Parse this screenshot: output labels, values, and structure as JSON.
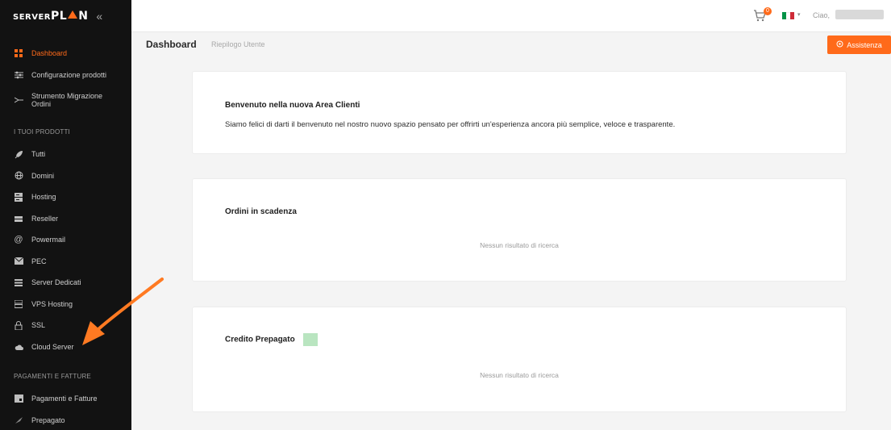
{
  "brand": {
    "logo_small": "SERVER",
    "logo_big_a": "PL",
    "logo_big_b": "N",
    "collapse_icon": "double-chevron-left-icon"
  },
  "sidebar": {
    "items_top": [
      {
        "label": "Dashboard",
        "icon": "grid-icon",
        "active": true
      },
      {
        "label": "Configurazione prodotti",
        "icon": "sliders-icon"
      },
      {
        "label": "Strumento Migrazione Ordini",
        "icon": "migrate-icon"
      }
    ],
    "section_products": "I TUOI PRODOTTI",
    "items_products": [
      {
        "label": "Tutti",
        "icon": "rocket-icon"
      },
      {
        "label": "Domini",
        "icon": "globe-icon"
      },
      {
        "label": "Hosting",
        "icon": "server-icon"
      },
      {
        "label": "Reseller",
        "icon": "reseller-icon"
      },
      {
        "label": "Powermail",
        "icon": "at-icon"
      },
      {
        "label": "PEC",
        "icon": "mail-icon"
      },
      {
        "label": "Server Dedicati",
        "icon": "rack-icon"
      },
      {
        "label": "VPS Hosting",
        "icon": "vps-icon"
      },
      {
        "label": "SSL",
        "icon": "lock-icon"
      },
      {
        "label": "Cloud Server",
        "icon": "cloud-icon"
      }
    ],
    "section_payments": "PAGAMENTI E FATTURE",
    "items_payments": [
      {
        "label": "Pagamenti e Fatture",
        "icon": "invoice-icon"
      },
      {
        "label": "Prepagato",
        "icon": "prepaid-icon"
      }
    ]
  },
  "topbar": {
    "cart_count": "0",
    "greeting": "Ciao,",
    "flag_colors": [
      "#009246",
      "#ffffff",
      "#ce2b37"
    ]
  },
  "page": {
    "title": "Dashboard",
    "subtitle": "Riepilogo Utente",
    "assist_label": "Assistenza"
  },
  "cards": {
    "welcome": {
      "title": "Benvenuto nella nuova Area Clienti",
      "text": "Siamo felici di darti il benvenuto nel nostro nuovo spazio pensato per offrirti un'esperienza ancora più semplice, veloce e trasparente."
    },
    "orders": {
      "title": "Ordini in scadenza",
      "empty": "Nessun risultato di ricerca"
    },
    "credit": {
      "title": "Credito Prepagato",
      "empty": "Nessun risultato di ricerca"
    }
  },
  "colors": {
    "accent": "#ff6a1a",
    "sidebar_bg": "#121212",
    "credit_badge": "#b9e5c0"
  }
}
